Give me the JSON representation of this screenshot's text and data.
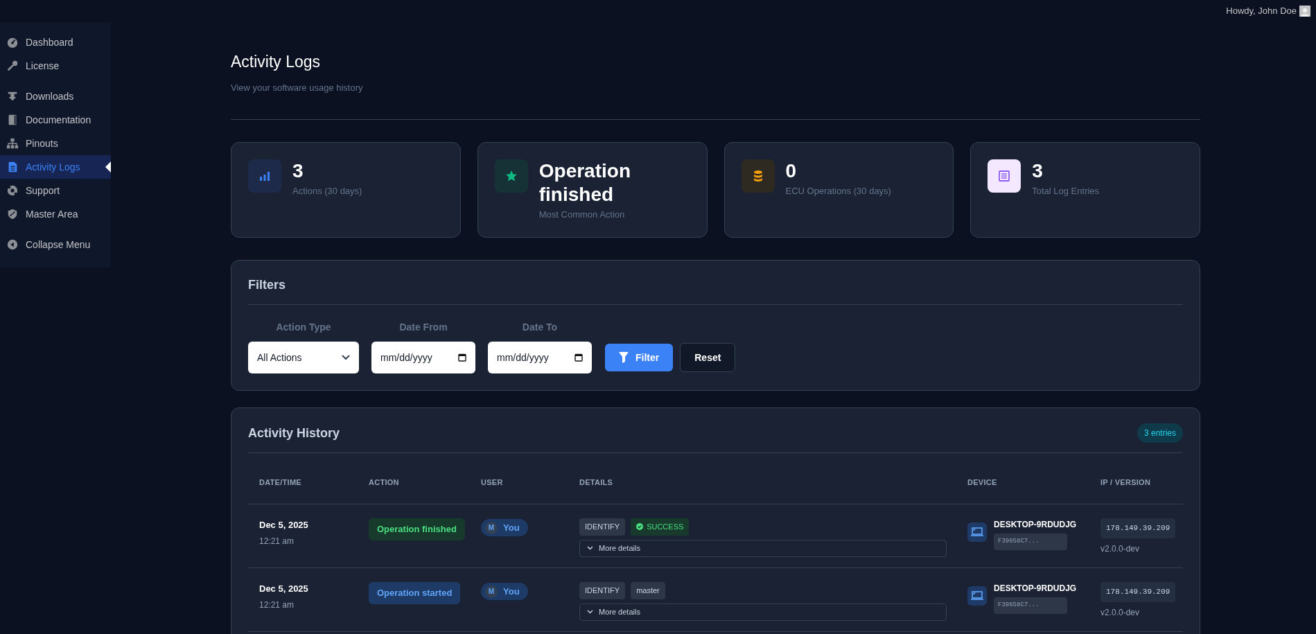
{
  "top_bar": {
    "greeting": "Howdy, John Doe"
  },
  "sidebar": {
    "groups": [
      [
        {
          "label": "Dashboard",
          "selected": false
        },
        {
          "label": "License",
          "selected": false
        }
      ],
      [
        {
          "label": "Downloads",
          "selected": false
        },
        {
          "label": "Documentation",
          "selected": false
        },
        {
          "label": "Pinouts",
          "selected": false
        },
        {
          "label": "Activity Logs",
          "selected": true
        },
        {
          "label": "Support",
          "selected": false
        },
        {
          "label": "Master Area",
          "selected": false
        }
      ],
      [
        {
          "label": "Collapse Menu",
          "selected": false
        }
      ]
    ]
  },
  "page": {
    "title": "Activity Logs",
    "subtitle": "View your software usage history"
  },
  "stats": [
    {
      "value": "3",
      "label": "Actions (30 days)",
      "color": "#3b82f6"
    },
    {
      "value": "Operation finished",
      "label": "Most Common Action",
      "color": "#10b981"
    },
    {
      "value": "0",
      "label": "ECU Operations (30 days)",
      "color": "#f59e0b"
    },
    {
      "value": "3",
      "label": "Total Log Entries",
      "color": "#8b5cf6"
    }
  ],
  "filters": {
    "title": "Filters",
    "action_type": {
      "label": "Action Type",
      "value": "All Actions"
    },
    "date_from": {
      "label": "Date From",
      "placeholder": "mm/dd/yyyy"
    },
    "date_to": {
      "label": "Date To",
      "placeholder": "mm/dd/yyyy"
    },
    "filter_button": "Filter",
    "reset_button": "Reset"
  },
  "history": {
    "title": "Activity History",
    "count": "3 entries",
    "columns": [
      "DATE/TIME",
      "ACTION",
      "USER",
      "DETAILS",
      "DEVICE",
      "IP / VERSION"
    ],
    "rows": [
      {
        "date": "Dec 5, 2025",
        "time": "12:21 am",
        "action": {
          "label": "Operation finished",
          "kind": "finished"
        },
        "user": {
          "initial": "M",
          "name": "You"
        },
        "tags": [
          {
            "label": "IDENTIFY",
            "kind": "plain"
          },
          {
            "label": "SUCCESS",
            "kind": "success"
          }
        ],
        "more": "More details",
        "device": {
          "name": "DESKTOP-9RDUDJG",
          "id": "F39658C7..."
        },
        "ip": "178.149.39.209",
        "version": "v2.0.0-dev"
      },
      {
        "date": "Dec 5, 2025",
        "time": "12:21 am",
        "action": {
          "label": "Operation started",
          "kind": "started"
        },
        "user": {
          "initial": "M",
          "name": "You"
        },
        "tags": [
          {
            "label": "IDENTIFY",
            "kind": "plain"
          },
          {
            "label": "master",
            "kind": "plain"
          }
        ],
        "more": "More details",
        "device": {
          "name": "DESKTOP-9RDUDJG",
          "id": "F39658C7..."
        },
        "ip": "178.149.39.209",
        "version": "v2.0.0-dev"
      }
    ]
  }
}
